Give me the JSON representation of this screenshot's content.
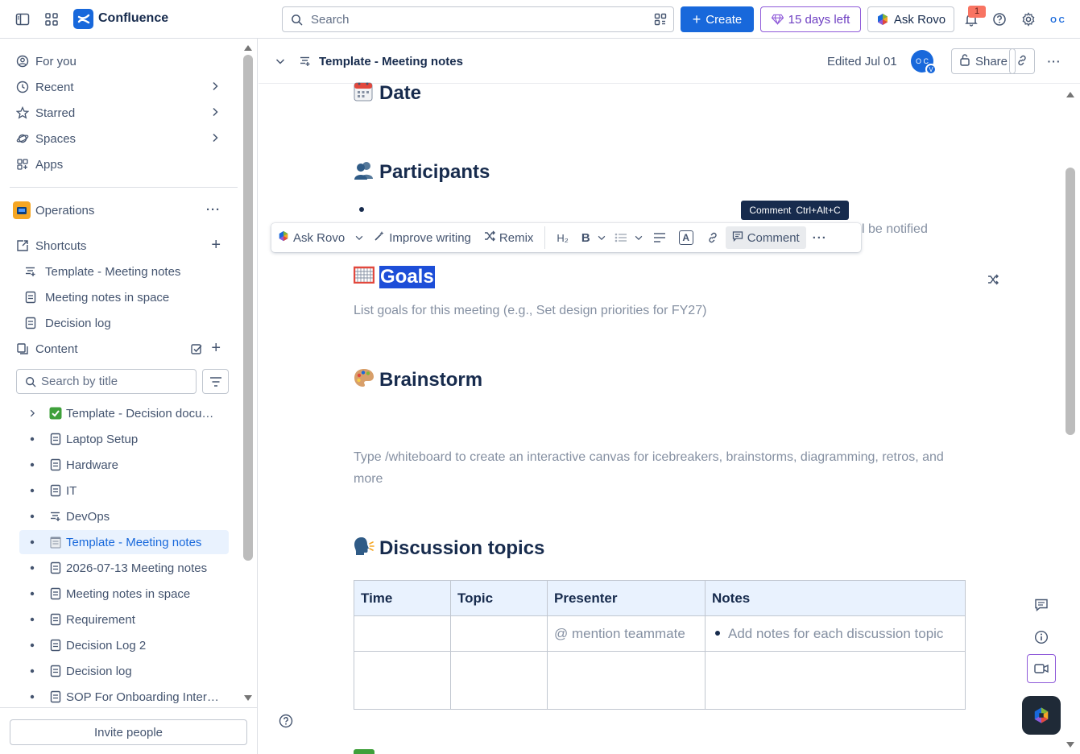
{
  "topnav": {
    "app_name": "Confluence",
    "search_placeholder": "Search",
    "create_label": "Create",
    "trial_label": "15 days left",
    "ask_rovo_label": "Ask Rovo",
    "notification_count": "1",
    "avatar_initials": "O C",
    "brand_color": "#1868db"
  },
  "sidebar": {
    "nav": [
      {
        "label": "For you",
        "icon": "person-circle-icon"
      },
      {
        "label": "Recent",
        "icon": "clock-icon"
      },
      {
        "label": "Starred",
        "icon": "star-icon"
      },
      {
        "label": "Spaces",
        "icon": "planet-icon"
      },
      {
        "label": "Apps",
        "icon": "apps-icon"
      }
    ],
    "space_name": "Operations",
    "shortcuts_label": "Shortcuts",
    "shortcuts": [
      {
        "label": "Template - Meeting notes",
        "icon": "meeting-notes-icon"
      },
      {
        "label": "Meeting notes in space",
        "icon": "page-icon"
      },
      {
        "label": "Decision log",
        "icon": "page-icon"
      }
    ],
    "content_label": "Content",
    "title_search_placeholder": "Search by title",
    "tree": [
      {
        "label": "Template - Decision documentation",
        "icon": "check-emoji-icon"
      },
      {
        "label": "Laptop Setup",
        "icon": "page-icon"
      },
      {
        "label": "Hardware",
        "icon": "page-icon"
      },
      {
        "label": "IT",
        "icon": "page-icon"
      },
      {
        "label": "DevOps",
        "icon": "meeting-notes-icon"
      },
      {
        "label": "Template - Meeting notes",
        "icon": "notepad-emoji-icon"
      },
      {
        "label": "2026-07-13 Meeting notes",
        "icon": "page-icon"
      },
      {
        "label": "Meeting notes in space",
        "icon": "page-icon"
      },
      {
        "label": "Requirement",
        "icon": "page-icon"
      },
      {
        "label": "Decision Log 2",
        "icon": "page-icon"
      },
      {
        "label": "Decision log",
        "icon": "page-icon"
      },
      {
        "label": "SOP For Onboarding Interns",
        "icon": "page-icon"
      }
    ],
    "invite_label": "Invite people"
  },
  "page_header": {
    "title": "Template - Meeting notes",
    "edited": "Edited Jul 01",
    "avatar_initials": "O C",
    "avatar_badge": "V",
    "share_label": "Share"
  },
  "content": {
    "date_heading": "Date",
    "participants_heading": "Participants",
    "notified_fragment": "l be notified",
    "goals_heading": "Goals",
    "goals_placeholder": "List goals for this meeting (e.g., Set design priorities for FY27)",
    "brainstorm_heading": "Brainstorm",
    "brainstorm_placeholder": "Type /whiteboard to create an interactive canvas for icebreakers, brainstorms, diagramming, retros, and more",
    "discussion_heading": "Discussion topics",
    "table": {
      "headers": [
        "Time",
        "Topic",
        "Presenter",
        "Notes"
      ],
      "row1": [
        "",
        "",
        "@ mention teammate",
        "Add notes for each discussion topic"
      ]
    }
  },
  "tooltip": {
    "label": "Comment",
    "shortcut": "Ctrl+Alt+C"
  },
  "toolbar": {
    "ask_rovo": "Ask Rovo",
    "improve_writing": "Improve writing",
    "remix": "Remix",
    "heading_level": "H₂",
    "bold": "B",
    "text_color": "A",
    "comment": "Comment"
  }
}
